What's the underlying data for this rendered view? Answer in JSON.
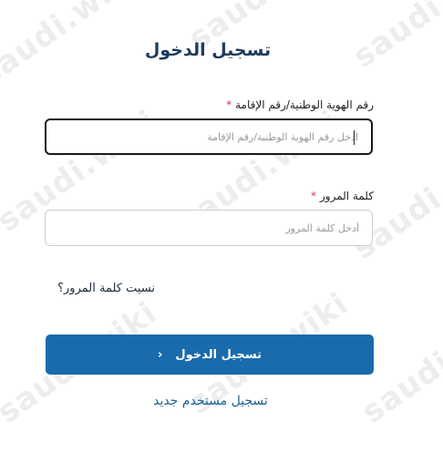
{
  "watermark": "saudi.wiki",
  "login": {
    "title": "تسجيل الدخول",
    "id_label": "رقم الهوية الوطنية/رقم الإقامة",
    "id_required_mark": "*",
    "id_placeholder": "ادخل رقم الهوية الوطنية/رقم الإقامة",
    "password_label": "كلمة المرور",
    "password_required_mark": "*",
    "password_placeholder": "أدخل كلمة المرور",
    "forgot_password": "نسيت كلمة المرور؟",
    "submit_label": "تسجيل الدخول",
    "submit_icon": "chevron-left-icon",
    "register_link": "تسجيل مستخدم جديد"
  },
  "colors": {
    "title": "#1d3c5c",
    "required": "#d9334a",
    "button": "#1a6bac",
    "link": "#1a5f8f"
  }
}
